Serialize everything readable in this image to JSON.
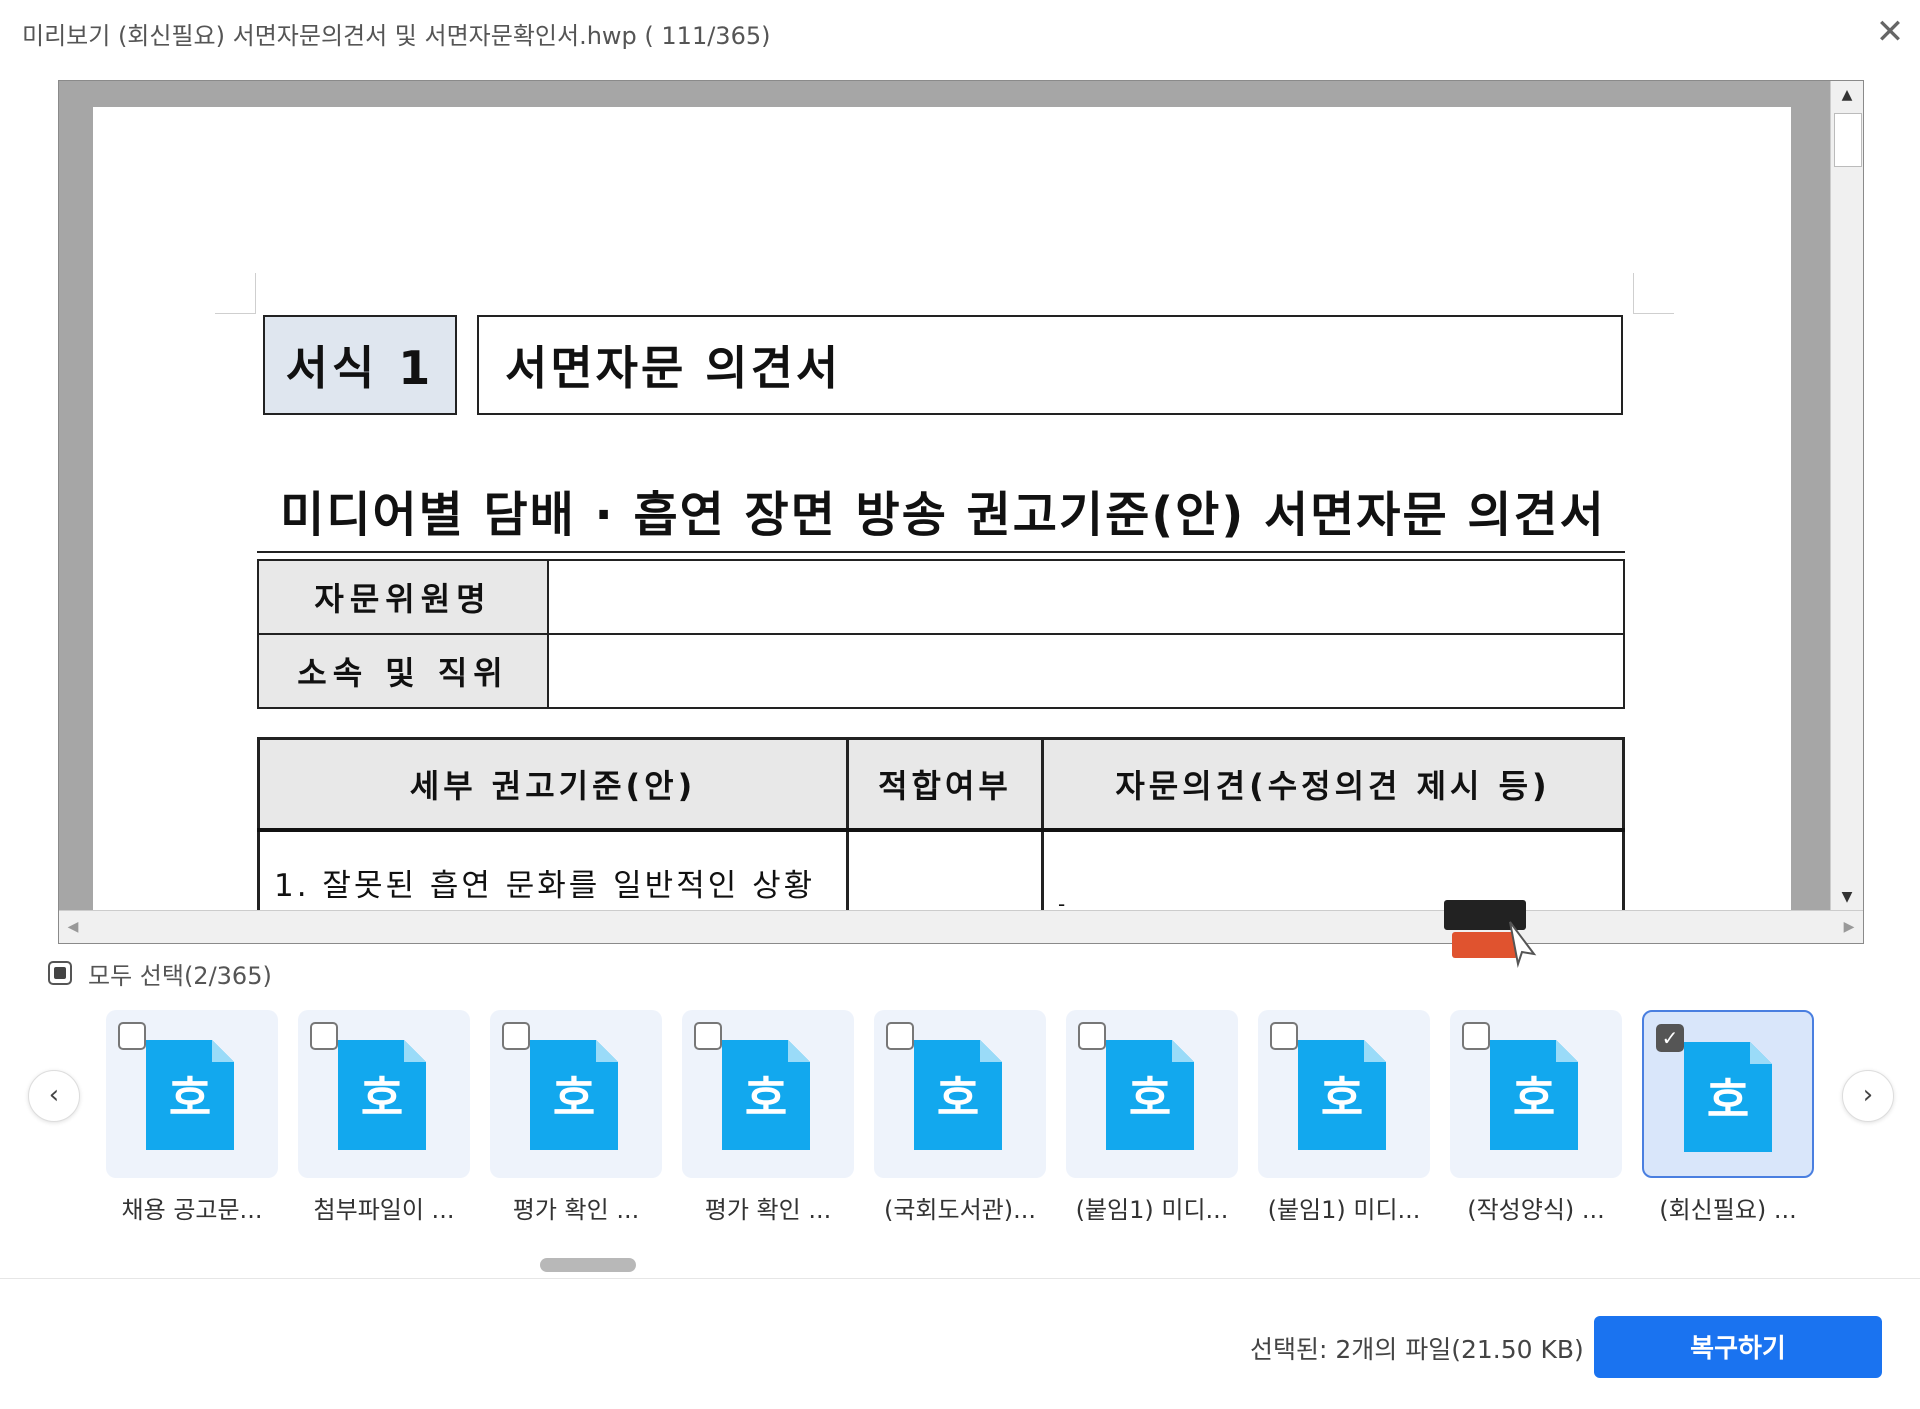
{
  "window": {
    "title": "미리보기 (회신필요) 서면자문의견서 및 서면자문확인서.hwp ( 111/365)",
    "close_icon": "close-icon"
  },
  "document": {
    "form_badge": "서식 1",
    "form_title": "서면자문 의견서",
    "heading": "미디어별 담배 · 흡연 장면 방송 권고기준(안) 서면자문 의견서",
    "info_rows": [
      {
        "label": "자문위원명",
        "value": ""
      },
      {
        "label": "소속 및 직위",
        "value": ""
      }
    ],
    "eval_table": {
      "headers": [
        "세부 권고기준(안)",
        "적합여부",
        "자문의견(수정의견 제시 등)"
      ],
      "rows": [
        [
          "1. 잘못된 흡연 문화를 일반적인 상황",
          "",
          "-"
        ]
      ]
    }
  },
  "select_all": {
    "label": "모두 선택(2/365)",
    "state": "partial"
  },
  "files": [
    {
      "name": "채용 공고문...",
      "checked": false,
      "icon": "hwp-file-icon",
      "glyph": "호"
    },
    {
      "name": "첨부파일이 ...",
      "checked": false,
      "icon": "hwp-file-icon",
      "glyph": "호"
    },
    {
      "name": "평가 확인 ...",
      "checked": false,
      "icon": "hwp-file-icon",
      "glyph": "호"
    },
    {
      "name": "평가 확인 ...",
      "checked": false,
      "icon": "hwp-file-icon",
      "glyph": "호"
    },
    {
      "name": "(국회도서관)...",
      "checked": false,
      "icon": "hwp-file-icon",
      "glyph": "호"
    },
    {
      "name": "(붙임1) 미디...",
      "checked": false,
      "icon": "hwp-file-icon",
      "glyph": "호"
    },
    {
      "name": "(붙임1) 미디...",
      "checked": false,
      "icon": "hwp-file-icon",
      "glyph": "호"
    },
    {
      "name": "(작성양식) ...",
      "checked": false,
      "icon": "hwp-file-icon",
      "glyph": "호"
    },
    {
      "name": "(회신필요) ...",
      "checked": true,
      "icon": "hwp-file-icon",
      "glyph": "호"
    }
  ],
  "footer": {
    "status": "선택된: 2개의 파일(21.50 KB)",
    "recover_label": "복구하기"
  },
  "colors": {
    "accent": "#1a73f0",
    "file_icon": "#12a8ee",
    "badge_bg": "#dfe6ef"
  }
}
